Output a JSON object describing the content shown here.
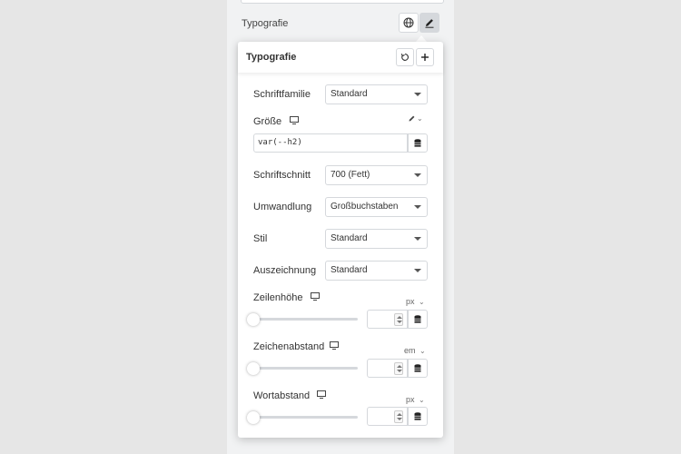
{
  "section": {
    "label": "Typografie"
  },
  "popover": {
    "title": "Typografie"
  },
  "fields": {
    "font_family": {
      "label": "Schriftfamilie",
      "value": "Standard"
    },
    "size": {
      "label": "Größe",
      "value": "var(--h2)"
    },
    "font_weight": {
      "label": "Schriftschnitt",
      "value": "700 (Fett)"
    },
    "transform": {
      "label": "Umwandlung",
      "value": "Großbuchstaben"
    },
    "style": {
      "label": "Stil",
      "value": "Standard"
    },
    "decoration": {
      "label": "Auszeichnung",
      "value": "Standard"
    },
    "line_height": {
      "label": "Zeilenhöhe",
      "unit": "px",
      "value": ""
    },
    "letter_spacing": {
      "label": "Zeichenabstand",
      "unit": "em",
      "value": ""
    },
    "word_spacing": {
      "label": "Wortabstand",
      "unit": "px",
      "value": ""
    }
  },
  "icons": {
    "globe": "globe-icon",
    "edit": "pencil-icon",
    "reset": "reset-icon",
    "add": "plus-icon",
    "responsive": "monitor-icon",
    "dynamic": "database-icon"
  },
  "colors": {
    "background": "#e6e6e6",
    "sidebar": "#f1f2f3",
    "border": "#d5d8dc",
    "panel": "#ffffff"
  }
}
